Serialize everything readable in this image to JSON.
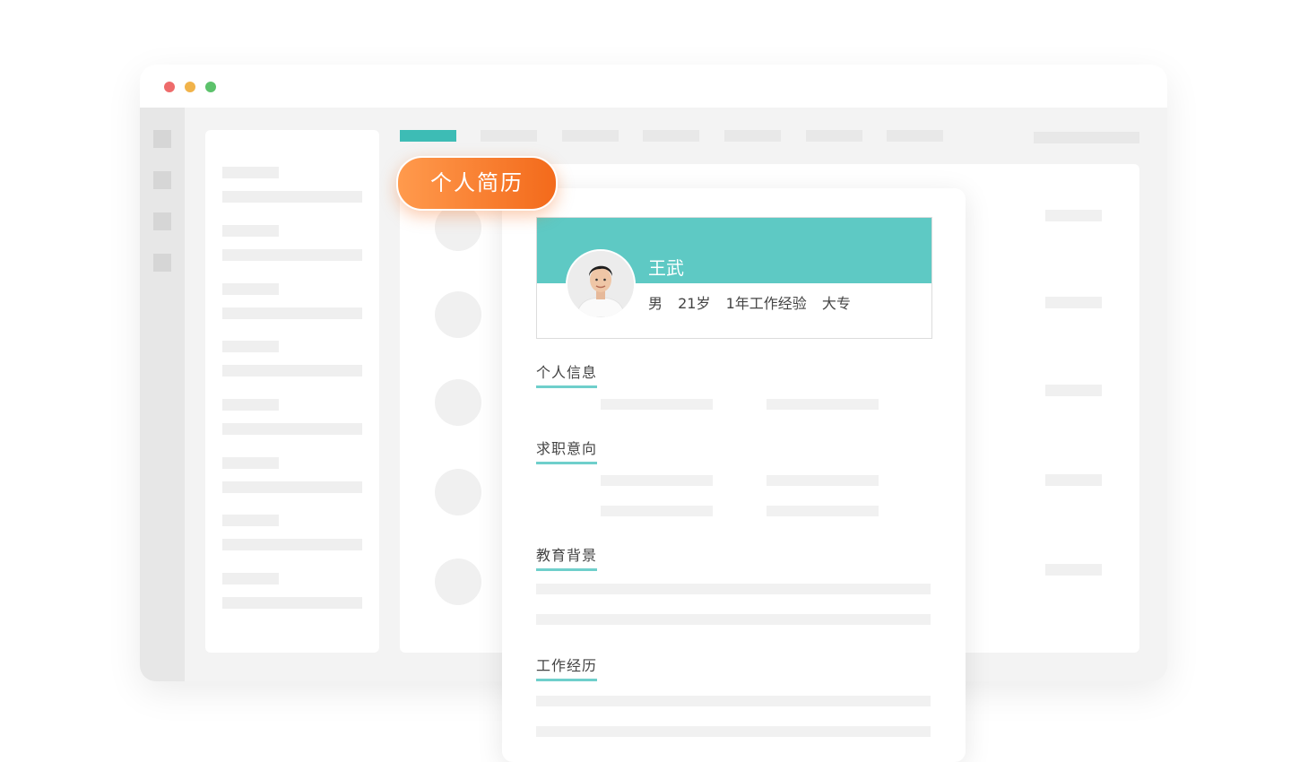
{
  "window": {
    "controls": [
      "close",
      "minimize",
      "maximize"
    ],
    "colors": {
      "close": "#ee6b6b",
      "minimize": "#f1b34a",
      "maximize": "#5cc26b"
    }
  },
  "topbar": {
    "active_tab_color": "#3dbcb5"
  },
  "badge": {
    "label": "个人简历",
    "color": "#f57a2a"
  },
  "resume": {
    "name": "王武",
    "gender": "男",
    "age": "21岁",
    "experience": "1年工作经验",
    "education": "大专",
    "accent": "#5ec9c4",
    "sections": {
      "personal_info": "个人信息",
      "job_intention": "求职意向",
      "education_background": "教育背景",
      "work_experience": "工作经历"
    }
  }
}
